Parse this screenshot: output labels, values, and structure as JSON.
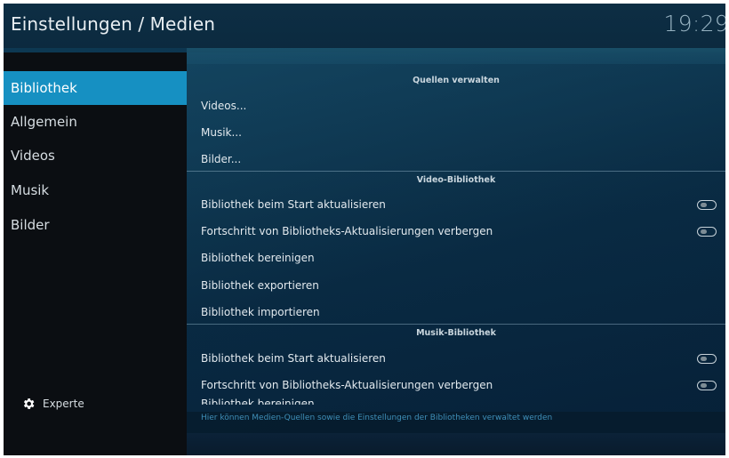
{
  "header": {
    "title": "Einstellungen / Medien",
    "clock": "19:29"
  },
  "sidebar": {
    "items": [
      {
        "label": "Bibliothek",
        "active": true
      },
      {
        "label": "Allgemein",
        "active": false
      },
      {
        "label": "Videos",
        "active": false
      },
      {
        "label": "Musik",
        "active": false
      },
      {
        "label": "Bilder",
        "active": false
      }
    ],
    "expert_label": "Experte",
    "expert_icon": "gear-icon"
  },
  "sections": {
    "quellen": {
      "title": "Quellen verwalten",
      "items": [
        "Videos...",
        "Musik...",
        "Bilder..."
      ]
    },
    "video": {
      "title": "Video-Bibliothek",
      "items": [
        "Bibliothek beim Start aktualisieren",
        "Fortschritt von Bibliotheks-Aktualisierungen verbergen",
        "Bibliothek bereinigen",
        "Bibliothek exportieren",
        "Bibliothek importieren"
      ]
    },
    "musik": {
      "title": "Musik-Bibliothek",
      "items": [
        "Bibliothek beim Start aktualisieren",
        "Fortschritt von Bibliotheks-Aktualisierungen verbergen",
        "Bibliothek bereinigen"
      ]
    }
  },
  "toggles": {
    "video_update_on_start": false,
    "video_hide_progress": false,
    "music_update_on_start": false,
    "music_hide_progress": false
  },
  "description": "Hier können Medien-Quellen sowie die Einstellungen der Bibliotheken verwaltet werden",
  "colors": {
    "accent": "#1690c2",
    "description_text": "#3f8fb8"
  }
}
